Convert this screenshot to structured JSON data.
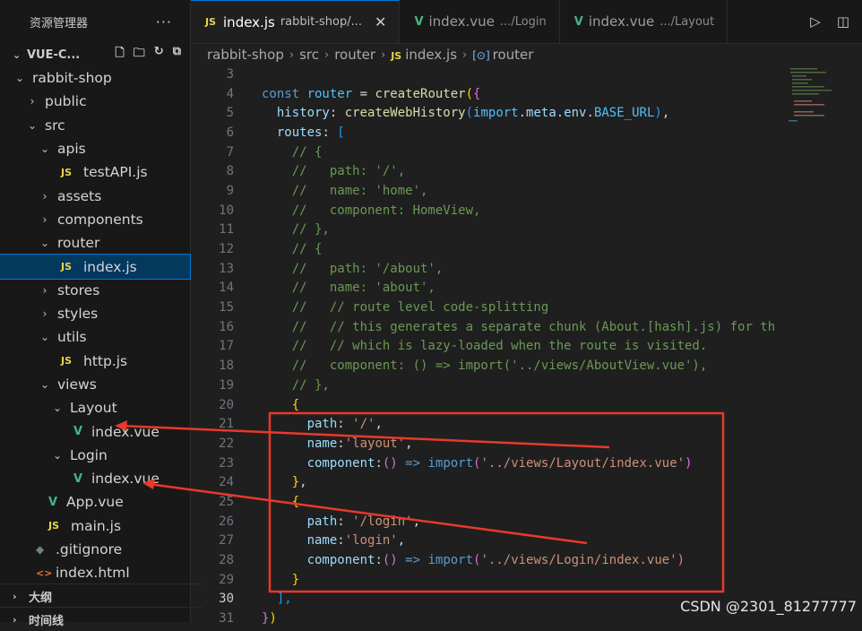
{
  "sidebar": {
    "title": "资源管理器",
    "more": "···",
    "root": "VUE-C...",
    "tree": [
      {
        "label": "rabbit-shop",
        "type": "folder-open",
        "depth": 1
      },
      {
        "label": "public",
        "type": "folder",
        "depth": 2
      },
      {
        "label": "src",
        "type": "folder-open",
        "depth": 2
      },
      {
        "label": "apis",
        "type": "folder-open",
        "depth": 3
      },
      {
        "label": "testAPI.js",
        "type": "js",
        "depth": 4
      },
      {
        "label": "assets",
        "type": "folder",
        "depth": 3
      },
      {
        "label": "components",
        "type": "folder",
        "depth": 3
      },
      {
        "label": "router",
        "type": "folder-open",
        "depth": 3
      },
      {
        "label": "index.js",
        "type": "js",
        "depth": 4,
        "selected": true
      },
      {
        "label": "stores",
        "type": "folder",
        "depth": 3
      },
      {
        "label": "styles",
        "type": "folder",
        "depth": 3
      },
      {
        "label": "utils",
        "type": "folder-open",
        "depth": 3
      },
      {
        "label": "http.js",
        "type": "js",
        "depth": 4
      },
      {
        "label": "views",
        "type": "folder-open",
        "depth": 3
      },
      {
        "label": "Layout",
        "type": "folder-open",
        "depth": 4
      },
      {
        "label": "index.vue",
        "type": "vue",
        "depth": 5
      },
      {
        "label": "Login",
        "type": "folder-open",
        "depth": 4
      },
      {
        "label": "index.vue",
        "type": "vue",
        "depth": 5
      },
      {
        "label": "App.vue",
        "type": "vue",
        "depth": 3
      },
      {
        "label": "main.js",
        "type": "js",
        "depth": 3
      },
      {
        "label": ".gitignore",
        "type": "git",
        "depth": 2
      },
      {
        "label": "index.html",
        "type": "html",
        "depth": 2
      }
    ],
    "sections": [
      "大纲",
      "时间线"
    ]
  },
  "tabs": [
    {
      "icon": "JS",
      "label": "index.js",
      "desc": "rabbit-shop/...",
      "active": true,
      "close": "✕"
    },
    {
      "icon": "V",
      "label": "index.vue",
      "desc": ".../Login",
      "active": false
    },
    {
      "icon": "V",
      "label": "index.vue",
      "desc": ".../Layout",
      "active": false
    }
  ],
  "breadcrumb": [
    "rabbit-shop",
    "src",
    "router",
    "index.js",
    "router"
  ],
  "breadcrumb_icons": {
    "file": "JS",
    "symbol": "[⊙]"
  },
  "code": {
    "current_line": 30,
    "lines": [
      {
        "n": "3",
        "segs": []
      },
      {
        "n": "4",
        "segs": [
          [
            "kw",
            "const "
          ],
          [
            "var",
            "router"
          ],
          [
            "punc",
            " = "
          ],
          [
            "fn",
            "createRouter"
          ],
          [
            "b1",
            "("
          ],
          [
            "b2",
            "{"
          ]
        ]
      },
      {
        "n": "5",
        "segs": [
          [
            "punc",
            "  "
          ],
          [
            "prop",
            "history"
          ],
          [
            "punc",
            ": "
          ],
          [
            "fn",
            "createWebHistory"
          ],
          [
            "b3",
            "("
          ],
          [
            "var",
            "import"
          ],
          [
            "punc",
            "."
          ],
          [
            "prop",
            "meta"
          ],
          [
            "punc",
            "."
          ],
          [
            "prop",
            "env"
          ],
          [
            "punc",
            "."
          ],
          [
            "var",
            "BASE_URL"
          ],
          [
            "b3",
            ")"
          ],
          [
            "punc",
            ","
          ]
        ]
      },
      {
        "n": "6",
        "segs": [
          [
            "punc",
            "  "
          ],
          [
            "prop",
            "routes"
          ],
          [
            "punc",
            ": "
          ],
          [
            "b3",
            "["
          ]
        ]
      },
      {
        "n": "7",
        "segs": [
          [
            "cm",
            "    // {"
          ]
        ]
      },
      {
        "n": "8",
        "segs": [
          [
            "cm",
            "    //   path: '/',"
          ]
        ]
      },
      {
        "n": "9",
        "segs": [
          [
            "cm",
            "    //   name: 'home',"
          ]
        ]
      },
      {
        "n": "10",
        "segs": [
          [
            "cm",
            "    //   component: HomeView,"
          ]
        ]
      },
      {
        "n": "11",
        "segs": [
          [
            "cm",
            "    // },"
          ]
        ]
      },
      {
        "n": "12",
        "segs": [
          [
            "cm",
            "    // {"
          ]
        ]
      },
      {
        "n": "13",
        "segs": [
          [
            "cm",
            "    //   path: '/about',"
          ]
        ]
      },
      {
        "n": "14",
        "segs": [
          [
            "cm",
            "    //   name: 'about',"
          ]
        ]
      },
      {
        "n": "15",
        "segs": [
          [
            "cm",
            "    //   // route level code-splitting"
          ]
        ]
      },
      {
        "n": "16",
        "segs": [
          [
            "cm",
            "    //   // this generates a separate chunk (About.[hash].js) for th"
          ]
        ]
      },
      {
        "n": "17",
        "segs": [
          [
            "cm",
            "    //   // which is lazy-loaded when the route is visited."
          ]
        ]
      },
      {
        "n": "18",
        "segs": [
          [
            "cm",
            "    //   component: () => import('../views/AboutView.vue'),"
          ]
        ]
      },
      {
        "n": "19",
        "segs": [
          [
            "cm",
            "    // },"
          ]
        ]
      },
      {
        "n": "20",
        "segs": [
          [
            "punc",
            "    "
          ],
          [
            "b1",
            "{"
          ]
        ]
      },
      {
        "n": "21",
        "segs": [
          [
            "punc",
            "      "
          ],
          [
            "prop",
            "path"
          ],
          [
            "punc",
            ": "
          ],
          [
            "str",
            "'/'"
          ],
          [
            "punc",
            ","
          ]
        ]
      },
      {
        "n": "22",
        "segs": [
          [
            "punc",
            "      "
          ],
          [
            "prop",
            "name"
          ],
          [
            "punc",
            ":"
          ],
          [
            "str",
            "'layout'"
          ],
          [
            "punc",
            ","
          ]
        ]
      },
      {
        "n": "23",
        "segs": [
          [
            "punc",
            "      "
          ],
          [
            "prop",
            "component"
          ],
          [
            "punc",
            ":"
          ],
          [
            "b2",
            "()"
          ],
          [
            "punc",
            " "
          ],
          [
            "kw",
            "=>"
          ],
          [
            "punc",
            " "
          ],
          [
            "kw",
            "import"
          ],
          [
            "b2",
            "("
          ],
          [
            "str",
            "'../views/Layout/index.vue'"
          ],
          [
            "b2",
            ")"
          ]
        ]
      },
      {
        "n": "24",
        "segs": [
          [
            "punc",
            "    "
          ],
          [
            "b1",
            "}"
          ],
          [
            "punc",
            ","
          ]
        ]
      },
      {
        "n": "25",
        "segs": [
          [
            "punc",
            "    "
          ],
          [
            "b1",
            "{"
          ]
        ]
      },
      {
        "n": "26",
        "segs": [
          [
            "punc",
            "      "
          ],
          [
            "prop",
            "path"
          ],
          [
            "punc",
            ": "
          ],
          [
            "str",
            "'/login'"
          ],
          [
            "punc",
            ","
          ]
        ]
      },
      {
        "n": "27",
        "segs": [
          [
            "punc",
            "      "
          ],
          [
            "prop",
            "name"
          ],
          [
            "punc",
            ":"
          ],
          [
            "str",
            "'login'"
          ],
          [
            "punc",
            ","
          ]
        ]
      },
      {
        "n": "28",
        "segs": [
          [
            "punc",
            "      "
          ],
          [
            "prop",
            "component"
          ],
          [
            "punc",
            ":"
          ],
          [
            "b2",
            "()"
          ],
          [
            "punc",
            " "
          ],
          [
            "kw",
            "=>"
          ],
          [
            "punc",
            " "
          ],
          [
            "kw",
            "import"
          ],
          [
            "b2",
            "("
          ],
          [
            "str",
            "'../views/Login/index.vue'"
          ],
          [
            "b2",
            ")"
          ]
        ]
      },
      {
        "n": "29",
        "segs": [
          [
            "punc",
            "    "
          ],
          [
            "b1",
            "}"
          ]
        ]
      },
      {
        "n": "30",
        "segs": [
          [
            "punc",
            "  "
          ],
          [
            "b3",
            "],"
          ]
        ]
      },
      {
        "n": "31",
        "segs": [
          [
            "b2",
            "}"
          ],
          [
            "b1",
            ")"
          ]
        ]
      }
    ]
  },
  "watermark": "CSDN @2301_81277777",
  "colors": {
    "annotation": "#e8392c",
    "accent": "#0078d4"
  }
}
